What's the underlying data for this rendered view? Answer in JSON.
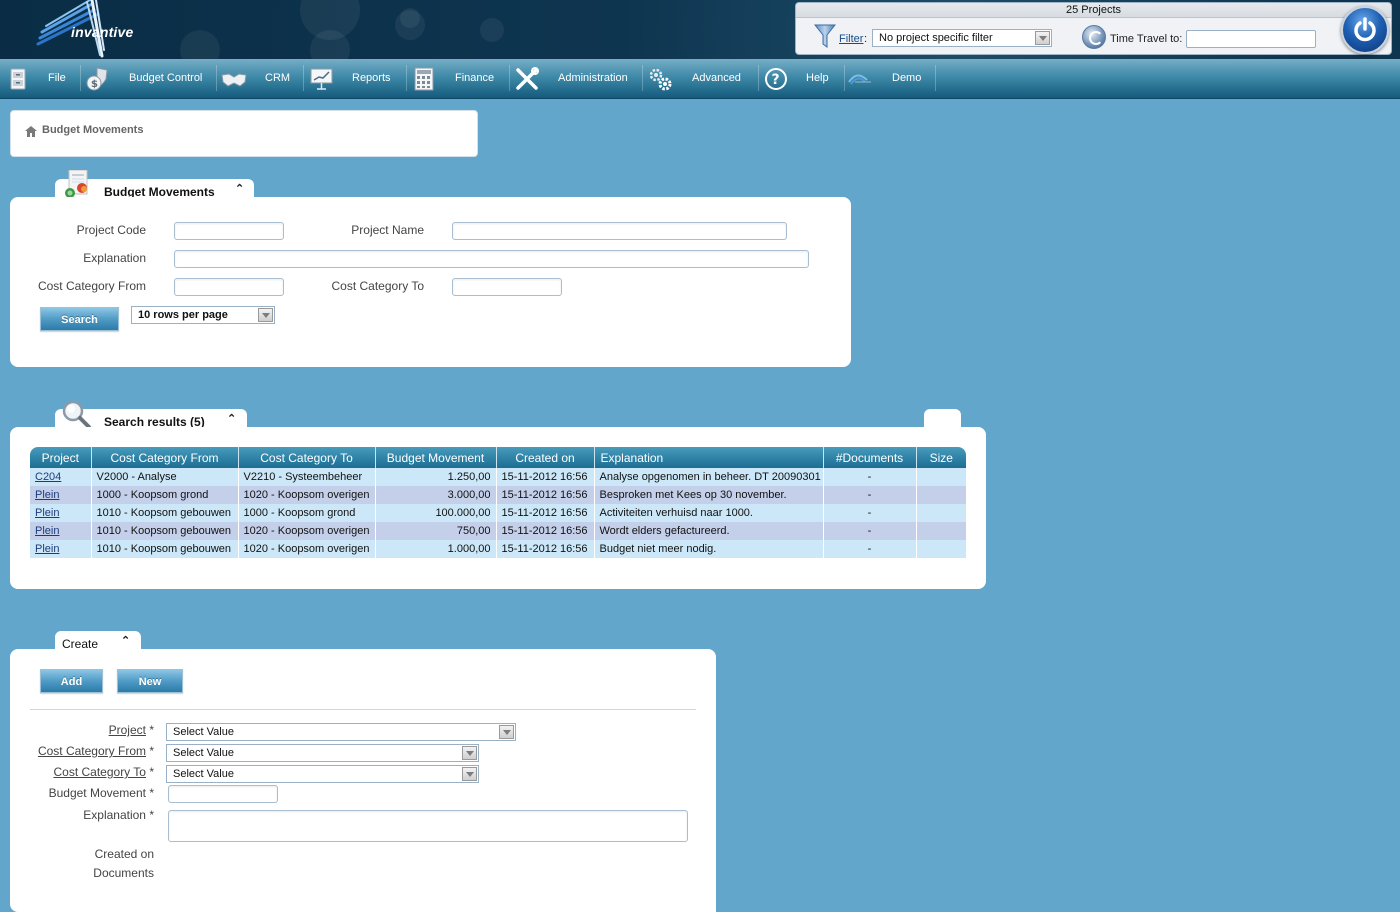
{
  "header": {
    "logo_text": "invantive",
    "project_count": "25 Projects",
    "filter_link": "Filter",
    "filter_colon": ":",
    "filter_value": "No project specific filter",
    "time_travel_label": "Time Travel to:",
    "time_travel_value": ""
  },
  "menu": {
    "items": [
      {
        "label": "File",
        "icon": "file-cabinet-icon"
      },
      {
        "label": "Budget Control",
        "icon": "money-bag-shield-icon"
      },
      {
        "label": "CRM",
        "icon": "handshake-icon"
      },
      {
        "label": "Reports",
        "icon": "presentation-chart-icon"
      },
      {
        "label": "Finance",
        "icon": "calculator-icon"
      },
      {
        "label": "Administration",
        "icon": "tools-icon"
      },
      {
        "label": "Advanced",
        "icon": "gears-icon"
      },
      {
        "label": "Help",
        "icon": "help-circle-icon"
      },
      {
        "label": "Demo",
        "icon": "demo-logo-icon"
      }
    ]
  },
  "breadcrumb": {
    "items": [
      "Budget Movements"
    ]
  },
  "search_panel": {
    "tab_title": "Budget Movements",
    "collapse_glyph": "»",
    "fields": {
      "project_code_label": "Project Code",
      "project_code_value": "",
      "project_name_label": "Project Name",
      "project_name_value": "",
      "explanation_label": "Explanation",
      "explanation_value": "",
      "cost_category_from_label": "Cost Category From",
      "cost_category_from_value": "",
      "cost_category_to_label": "Cost Category To",
      "cost_category_to_value": ""
    },
    "search_button": "Search",
    "rows_per_page": "10 rows per page"
  },
  "results_panel": {
    "tab_title": "Search results (5)",
    "columns": [
      "Project",
      "Cost Category From",
      "Cost Category To",
      "Budget Movement",
      "Created on",
      "Explanation",
      "#Documents",
      "Size"
    ],
    "rows": [
      {
        "project": "C204",
        "from": "V2000 - Analyse",
        "to": "V2210 - Systeembeheer",
        "amount": "1.250,00",
        "created": "15-11-2012 16:56",
        "explanation": "Analyse opgenomen in beheer. DT 20090301",
        "documents": "-",
        "size": ""
      },
      {
        "project": "Plein",
        "from": "1000 - Koopsom grond",
        "to": "1020 - Koopsom overigen",
        "amount": "3.000,00",
        "created": "15-11-2012 16:56",
        "explanation": "Besproken met Kees op 30 november.",
        "documents": "-",
        "size": ""
      },
      {
        "project": "Plein",
        "from": "1010 - Koopsom gebouwen",
        "to": "1000 - Koopsom grond",
        "amount": "100.000,00",
        "created": "15-11-2012 16:56",
        "explanation": "Activiteiten verhuisd naar 1000.",
        "documents": "-",
        "size": ""
      },
      {
        "project": "Plein",
        "from": "1010 - Koopsom gebouwen",
        "to": "1020 - Koopsom overigen",
        "amount": "750,00",
        "created": "15-11-2012 16:56",
        "explanation": "Wordt elders gefactureerd.",
        "documents": "-",
        "size": ""
      },
      {
        "project": "Plein",
        "from": "1010 - Koopsom gebouwen",
        "to": "1020 - Koopsom overigen",
        "amount": "1.000,00",
        "created": "15-11-2012 16:56",
        "explanation": "Budget niet meer nodig.",
        "documents": "-",
        "size": ""
      }
    ]
  },
  "create_panel": {
    "tab_title": "Create",
    "add_button": "Add",
    "new_button": "New",
    "fields": {
      "project_label": "Project",
      "project_value": "Select Value",
      "cost_category_from_label": "Cost Category From",
      "cost_category_from_value": "Select Value",
      "cost_category_to_label": "Cost Category To",
      "cost_category_to_value": "Select Value",
      "budget_movement_label": "Budget Movement",
      "budget_movement_value": "",
      "explanation_label": "Explanation",
      "explanation_value": "",
      "created_on_label": "Created on",
      "documents_label": "Documents",
      "required_marker": "*"
    }
  },
  "colors": {
    "background": "#62a7cb",
    "header_dark": "#0a2d45",
    "menu_accent": "#3f8aa9",
    "row_odd": "#cce8f8",
    "row_even": "#c4d0ea",
    "button_blue": "#4f9cc6"
  }
}
